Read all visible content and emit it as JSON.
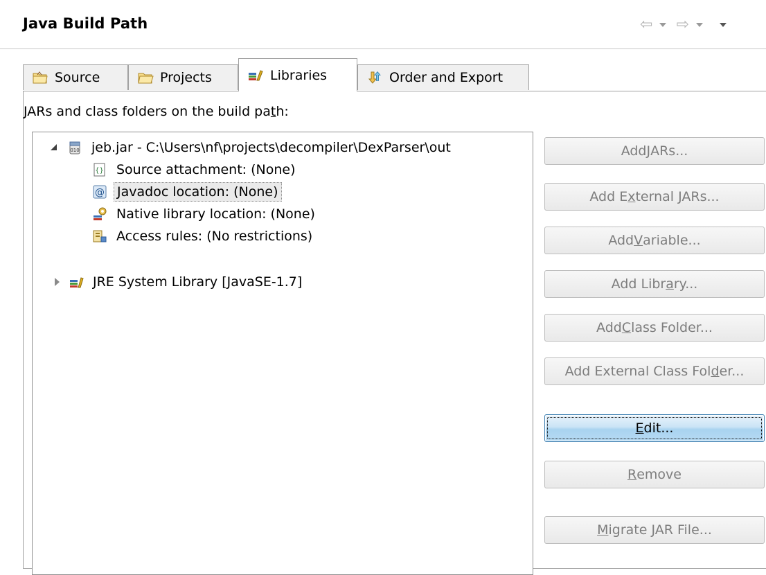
{
  "header": {
    "title": "Java Build Path",
    "nav": {
      "back_icon": "back-arrow-icon",
      "forward_icon": "forward-arrow-icon"
    }
  },
  "tabs": [
    {
      "label": "Source",
      "icon": "source-folder-icon"
    },
    {
      "label": "Projects",
      "icon": "projects-folder-icon"
    },
    {
      "label": "Libraries",
      "icon": "libraries-icon",
      "active": true
    },
    {
      "label": "Order and Export",
      "icon": "order-export-icon"
    }
  ],
  "libraries": {
    "section_label": "JARs and class folders on the build path:",
    "tree": [
      {
        "label": "jeb.jar - C:\\Users\\nf\\projects\\decompiler\\DexParser\\out",
        "icon": "jar-icon",
        "expanded": true
      },
      {
        "label": "Source attachment: (None)",
        "icon": "source-attachment-icon"
      },
      {
        "label": "Javadoc location: (None)",
        "icon": "javadoc-icon",
        "selected": true
      },
      {
        "label": "Native library location: (None)",
        "icon": "native-library-icon"
      },
      {
        "label": "Access rules: (No restrictions)",
        "icon": "access-rules-icon"
      },
      {
        "label": "JRE System Library [JavaSE-1.7]",
        "icon": "library-icon",
        "expanded": false
      }
    ],
    "buttons": {
      "add_jars": {
        "pre": "Add ",
        "u": "J",
        "post": "ARs..."
      },
      "add_external_jars": {
        "pre": "Add E",
        "u": "x",
        "post": "ternal JARs..."
      },
      "add_variable": {
        "pre": "Add ",
        "u": "V",
        "post": "ariable..."
      },
      "add_library": {
        "pre": "Add Libr",
        "u": "a",
        "post": "ry..."
      },
      "add_class_folder": {
        "pre": "Add ",
        "u": "C",
        "post": "lass Folder..."
      },
      "add_external_class_folder": {
        "pre": "Add External Class Fol",
        "u": "d",
        "post": "er..."
      },
      "edit": {
        "pre": "",
        "u": "E",
        "post": "dit..."
      },
      "remove": {
        "pre": "",
        "u": "R",
        "post": "emove"
      },
      "migrate_jar": {
        "pre": "",
        "u": "M",
        "post": "igrate JAR File..."
      }
    }
  },
  "colors": {
    "accent": "#3c7fb1",
    "disabled_text": "#7d7d7d"
  }
}
